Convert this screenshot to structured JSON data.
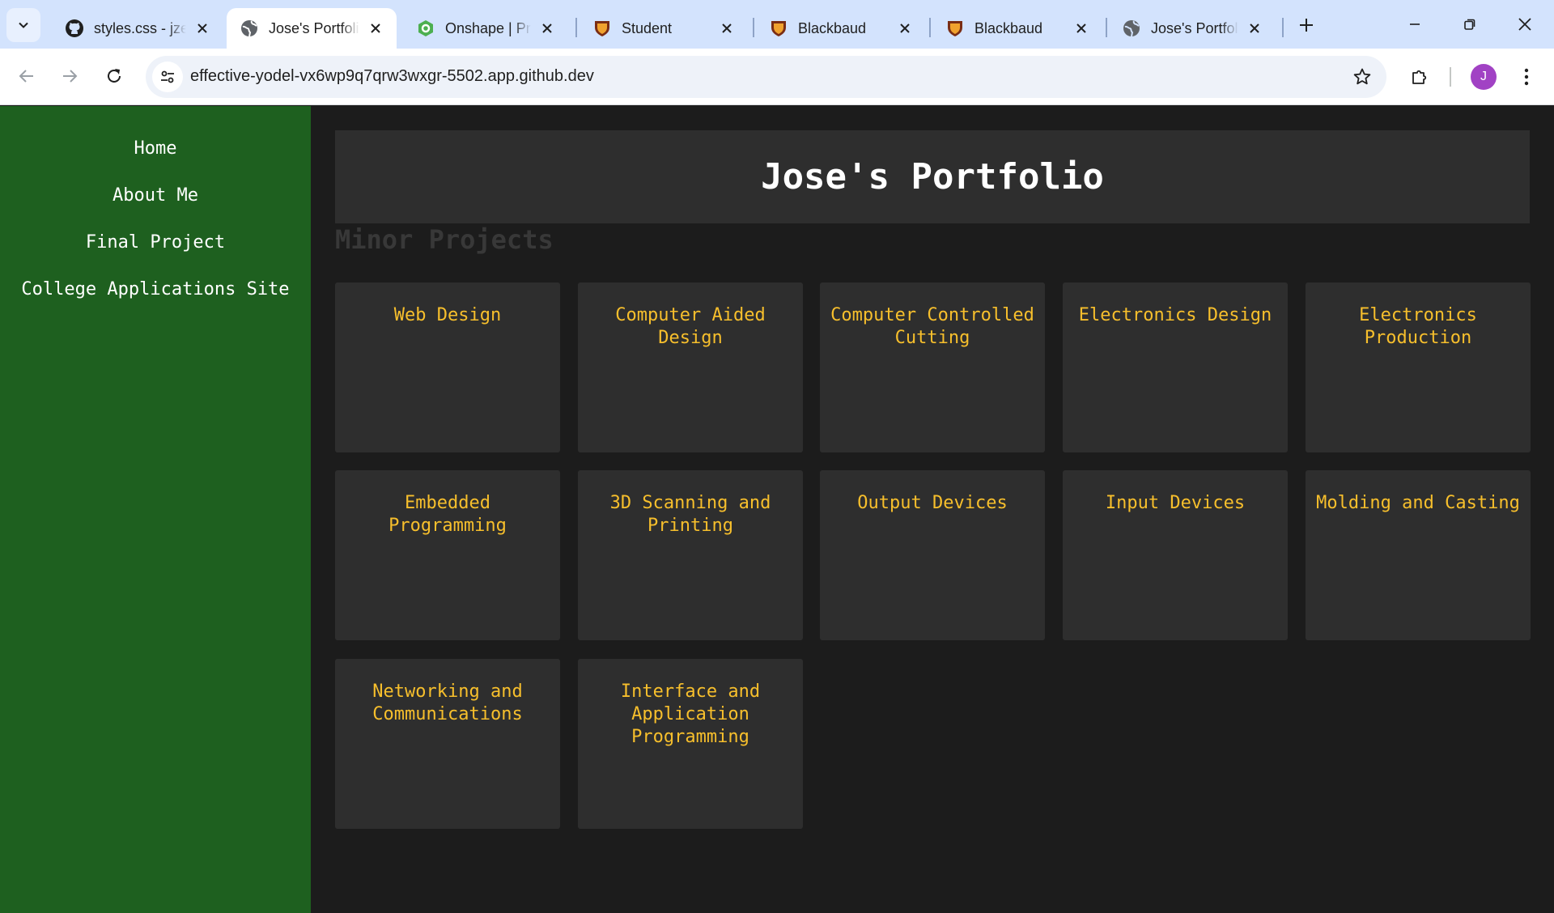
{
  "browser": {
    "tabs": [
      {
        "title": "styles.css - jzeledon",
        "icon": "github-icon",
        "active": false
      },
      {
        "title": "Jose's Portfolio",
        "icon": "globe-icon",
        "active": true
      },
      {
        "title": "Onshape | Projects",
        "icon": "onshape-icon",
        "active": false
      },
      {
        "title": "Student",
        "icon": "blackbaud-shield-icon",
        "active": false
      },
      {
        "title": "Blackbaud",
        "icon": "blackbaud-shield-icon",
        "active": false
      },
      {
        "title": "Blackbaud",
        "icon": "blackbaud-shield-icon",
        "active": false
      },
      {
        "title": "Jose's Portfolio",
        "icon": "globe-icon",
        "active": false
      }
    ],
    "url": "effective-yodel-vx6wp9q7qrw3wxgr-5502.app.github.dev",
    "profile_initial": "J",
    "colors": {
      "tabstrip": "#d3e3fd",
      "profile": "#a142c4"
    }
  },
  "sidebar": {
    "items": [
      {
        "label": "Home"
      },
      {
        "label": "About Me"
      },
      {
        "label": "Final Project"
      },
      {
        "label": "College Applications Site"
      }
    ],
    "color": "#1e601f"
  },
  "header": {
    "title": "Jose's Portfolio"
  },
  "section": {
    "title": "Minor Projects"
  },
  "projects": [
    {
      "label": "Web Design"
    },
    {
      "label": "Computer Aided Design"
    },
    {
      "label": "Computer Controlled Cutting"
    },
    {
      "label": "Electronics Design"
    },
    {
      "label": "Electronics Production"
    },
    {
      "label": "Embedded Programming"
    },
    {
      "label": "3D Scanning and Printing"
    },
    {
      "label": "Output Devices"
    },
    {
      "label": "Input Devices"
    },
    {
      "label": "Molding and Casting"
    },
    {
      "label": "Networking and Communications"
    },
    {
      "label": "Interface and Application Programming"
    }
  ],
  "theme": {
    "card_text": "#f7bf2c",
    "card_bg": "#2e2e2e",
    "page_bg": "#1c1c1c"
  }
}
